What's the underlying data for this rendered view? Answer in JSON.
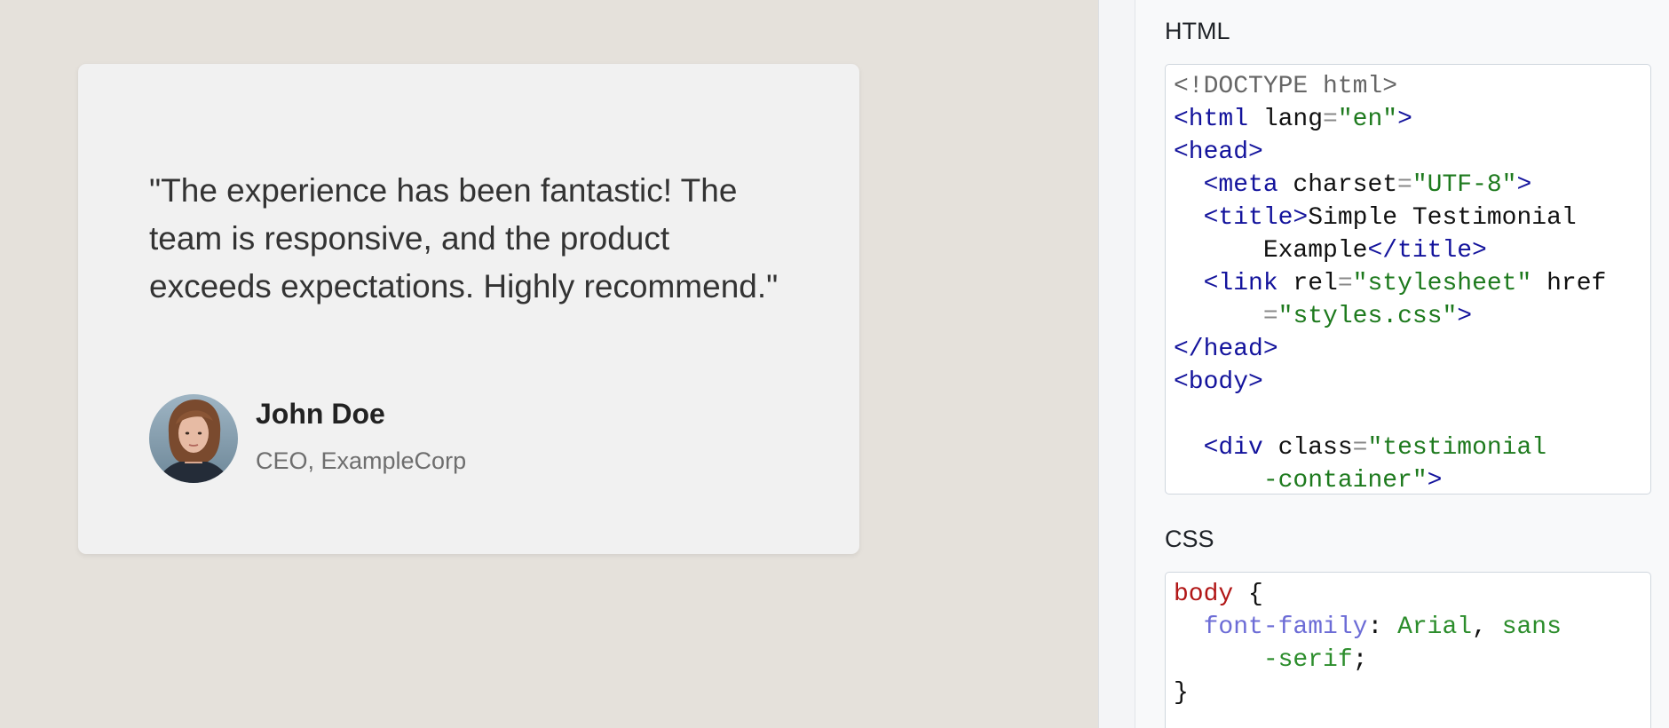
{
  "testimonial": {
    "quote": "\"The experience has been fantastic! The team is responsive, and the product exceeds expectations. Highly recommend.\"",
    "author_name": "John Doe",
    "author_title": "CEO, ExampleCorp",
    "avatar_icon": "person-photo-avatar"
  },
  "editor": {
    "html_label": "HTML",
    "css_label": "CSS",
    "html_lines": [
      [
        {
          "t": "doctype",
          "v": "<!DOCTYPE html>"
        }
      ],
      [
        {
          "t": "tag",
          "v": "<html"
        },
        {
          "t": "attr",
          "v": " lang"
        },
        {
          "t": "eq",
          "v": "="
        },
        {
          "t": "str",
          "v": "\"en\""
        },
        {
          "t": "tag",
          "v": ">"
        }
      ],
      [
        {
          "t": "tag",
          "v": "<head>"
        }
      ],
      [
        {
          "t": "text",
          "v": "  "
        },
        {
          "t": "tag",
          "v": "<meta"
        },
        {
          "t": "attr",
          "v": " charset"
        },
        {
          "t": "eq",
          "v": "="
        },
        {
          "t": "str",
          "v": "\"UTF-8\""
        },
        {
          "t": "tag",
          "v": ">"
        }
      ],
      [
        {
          "t": "text",
          "v": "  "
        },
        {
          "t": "tag",
          "v": "<title>"
        },
        {
          "t": "text",
          "v": "Simple Testimonial"
        }
      ],
      [
        {
          "t": "text",
          "v": "      Example"
        },
        {
          "t": "tag",
          "v": "</title>"
        }
      ],
      [
        {
          "t": "text",
          "v": "  "
        },
        {
          "t": "tag",
          "v": "<link"
        },
        {
          "t": "attr",
          "v": " rel"
        },
        {
          "t": "eq",
          "v": "="
        },
        {
          "t": "str",
          "v": "\"stylesheet\""
        },
        {
          "t": "attr",
          "v": " href"
        }
      ],
      [
        {
          "t": "text",
          "v": "      "
        },
        {
          "t": "eq",
          "v": "="
        },
        {
          "t": "str",
          "v": "\"styles.css\""
        },
        {
          "t": "tag",
          "v": ">"
        }
      ],
      [
        {
          "t": "tag",
          "v": "</head>"
        }
      ],
      [
        {
          "t": "tag",
          "v": "<body>"
        }
      ],
      [
        {
          "t": "text",
          "v": ""
        }
      ],
      [
        {
          "t": "text",
          "v": "  "
        },
        {
          "t": "tag",
          "v": "<div"
        },
        {
          "t": "attr",
          "v": " class"
        },
        {
          "t": "eq",
          "v": "="
        },
        {
          "t": "str",
          "v": "\"testimonial"
        }
      ],
      [
        {
          "t": "text",
          "v": "      "
        },
        {
          "t": "str",
          "v": "-container\""
        },
        {
          "t": "tag",
          "v": ">"
        }
      ]
    ],
    "css_lines": [
      [
        {
          "t": "sel",
          "v": "body"
        },
        {
          "t": "punc",
          "v": " {"
        }
      ],
      [
        {
          "t": "text",
          "v": "  "
        },
        {
          "t": "prop",
          "v": "font-family"
        },
        {
          "t": "punc",
          "v": ": "
        },
        {
          "t": "val",
          "v": "Arial"
        },
        {
          "t": "punc",
          "v": ", "
        },
        {
          "t": "val",
          "v": "sans"
        }
      ],
      [
        {
          "t": "text",
          "v": "      "
        },
        {
          "t": "val",
          "v": "-serif"
        },
        {
          "t": "punc",
          "v": ";"
        }
      ],
      [
        {
          "t": "punc",
          "v": "}"
        }
      ]
    ]
  }
}
